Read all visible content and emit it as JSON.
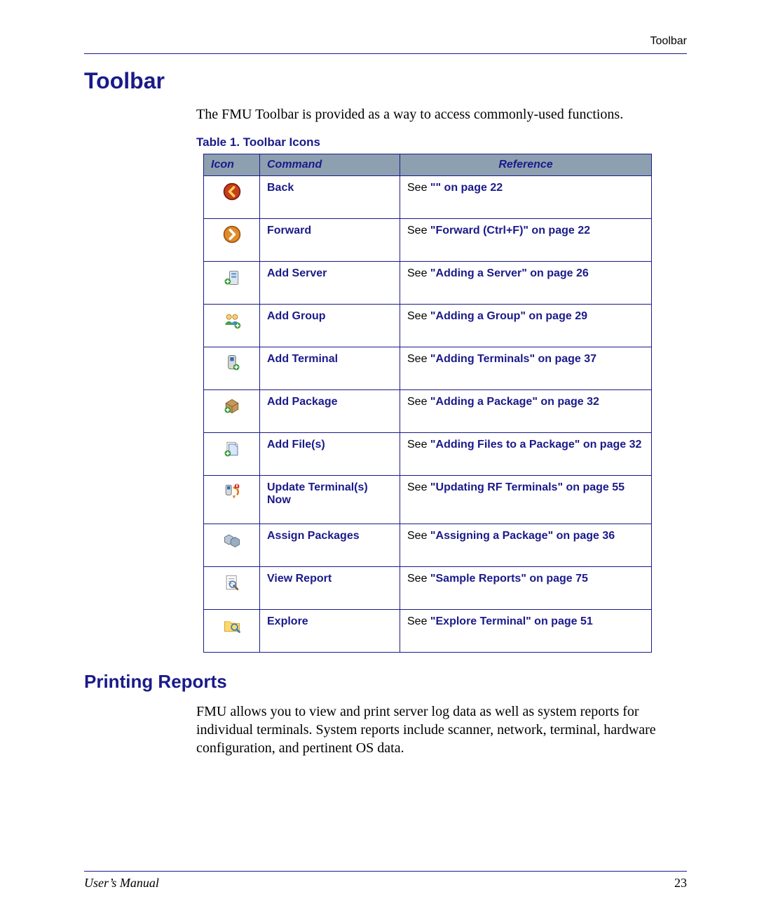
{
  "header": {
    "right": "Toolbar"
  },
  "heading1": "Toolbar",
  "intro": "The FMU Toolbar is provided as a way to access commonly-used functions.",
  "table_caption": "Table 1. Toolbar Icons",
  "columns": {
    "icon": "Icon",
    "command": "Command",
    "reference": "Reference"
  },
  "see_prefix": "See ",
  "rows": [
    {
      "icon": "back-icon",
      "command": "Back",
      "ref_link": "\"\" on page 22"
    },
    {
      "icon": "forward-icon",
      "command": "Forward",
      "ref_link": "\"Forward (Ctrl+F)\" on page 22"
    },
    {
      "icon": "add-server-icon",
      "command": "Add Server",
      "ref_link": "\"Adding a Server\" on page 26"
    },
    {
      "icon": "add-group-icon",
      "command": "Add Group",
      "ref_link": "\"Adding a Group\" on page 29"
    },
    {
      "icon": "add-terminal-icon",
      "command": "Add Terminal",
      "ref_link": "\"Adding Terminals\" on page 37"
    },
    {
      "icon": "add-package-icon",
      "command": "Add Package",
      "ref_link": "\"Adding a Package\" on page 32"
    },
    {
      "icon": "add-files-icon",
      "command": "Add File(s)",
      "ref_link": "\"Adding Files to a Package\" on page 32"
    },
    {
      "icon": "update-terminals-icon",
      "command": "Update Terminal(s) Now",
      "ref_link": "\"Updating RF Terminals\" on page 55"
    },
    {
      "icon": "assign-packages-icon",
      "command": "Assign Packages",
      "ref_link": "\"Assigning a Package\" on page 36"
    },
    {
      "icon": "view-report-icon",
      "command": "View Report",
      "ref_link": "\"Sample Reports\" on page 75"
    },
    {
      "icon": "explore-icon",
      "command": "Explore",
      "ref_link": "\"Explore Terminal\" on page 51"
    }
  ],
  "heading2": "Printing Reports",
  "body2": "FMU allows you to view and print server log data as well as system reports for individual terminals. System reports include scanner, network, terminal, hardware configuration, and pertinent OS data.",
  "footer": {
    "left": "User’s Manual",
    "pagenum": "23"
  }
}
